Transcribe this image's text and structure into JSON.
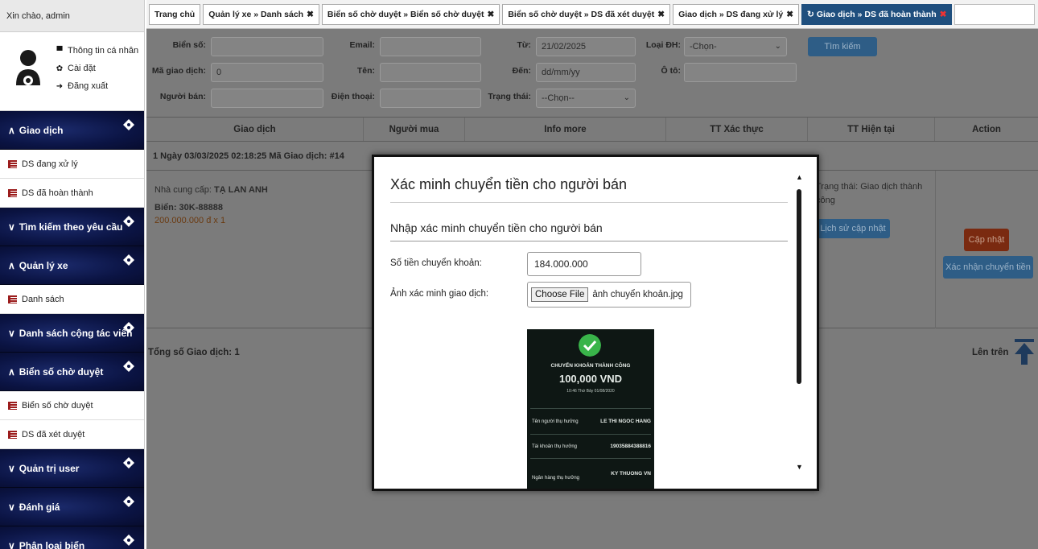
{
  "sidebar": {
    "greeting": "Xin chào, admin",
    "profile_links": [
      {
        "icon": "comment-icon",
        "label": "Thông tin cá nhân"
      },
      {
        "icon": "gear-icon",
        "label": "Cài đặt"
      },
      {
        "icon": "logout-icon",
        "label": "Đăng xuất"
      }
    ],
    "sections": [
      {
        "title": "Giao dịch",
        "expanded": true,
        "items": [
          "DS đang xử lý",
          "DS đã hoàn thành"
        ]
      },
      {
        "title": "Tìm kiếm theo yêu cầu",
        "expanded": false,
        "items": []
      },
      {
        "title": "Quản lý xe",
        "expanded": true,
        "items": [
          "Danh sách"
        ]
      },
      {
        "title": "Danh sách cộng tác viên",
        "expanded": false,
        "items": []
      },
      {
        "title": "Biển số chờ duyệt",
        "expanded": true,
        "items": [
          "Biển số chờ duyệt",
          "DS đã xét duyệt"
        ]
      },
      {
        "title": "Quản trị user",
        "expanded": false,
        "items": []
      },
      {
        "title": "Đánh giá",
        "expanded": false,
        "items": []
      },
      {
        "title": "Phân loại biển",
        "expanded": false,
        "items": []
      }
    ]
  },
  "tabs": [
    {
      "label": "Trang chủ",
      "closable": false
    },
    {
      "label": "Quản lý xe » Danh sách",
      "closable": true
    },
    {
      "label": "Biển số chờ duyệt » Biển số chờ duyệt",
      "closable": true
    },
    {
      "label": "Biển số chờ duyệt » DS đã xét duyệt",
      "closable": true
    },
    {
      "label": "Giao dịch » DS đang xử lý",
      "closable": true
    },
    {
      "label": "Giao dịch » DS đã hoàn thành",
      "closable": true,
      "active": true
    }
  ],
  "filters": {
    "bien_so_label": "Biển số:",
    "bien_so_value": "",
    "ma_gd_label": "Mã giao dịch:",
    "ma_gd_value": "0",
    "nguoi_ban_label": "Người bán:",
    "nguoi_ban_value": "",
    "email_label": "Email:",
    "email_value": "",
    "ten_label": "Tên:",
    "ten_value": "",
    "dien_thoai_label": "Điện thoại:",
    "dien_thoai_value": "",
    "tu_label": "Từ:",
    "tu_value": "21/02/2025",
    "den_label": "Đến:",
    "den_placeholder": "dd/mm/yy",
    "trang_thai_label": "Trạng thái:",
    "trang_thai_value": "--Chọn--",
    "loai_dh_label": "Loại ĐH:",
    "loai_dh_value": "-Chọn-",
    "oto_label": "Ô tô:",
    "oto_value": "",
    "search_button": "Tìm kiếm"
  },
  "table": {
    "columns": [
      "Giao dịch",
      "Người mua",
      "Info more",
      "TT Xác thực",
      "TT Hiện tại",
      "Action"
    ],
    "row_header": "1   Ngày 03/03/2025 02:18:25   Mã Giao dịch: #14",
    "provider_label": "Nhà cung cấp: ",
    "provider_name": "TẠ LAN ANH",
    "plate": "Biển: 30K-88888",
    "price": "200.000.000 đ x 1",
    "status_text": "Trạng thái: Giao dịch thành công",
    "history_button": "Lịch sử cập nhật",
    "update_button": "Cập nhật",
    "confirm_button": "Xác nhận chuyển tiền",
    "total": "Tổng số Giao dịch: 1",
    "to_top": "Lên trên"
  },
  "modal": {
    "title": "Xác minh chuyển tiền cho người bán",
    "subtitle": "Nhập xác minh chuyển tiền cho người bán",
    "amount_label": "Số tiền chuyển khoản:",
    "amount_value": "184.000.000",
    "image_label": "Ảnh xác minh giao dịch:",
    "file_button": "Choose File",
    "file_name": "ảnh chuyển khoản.jpg",
    "receipt": {
      "title": "CHUYỂN KHOẢN THÀNH CÔNG",
      "amount": "100,000 VND",
      "time": "10:46 Thứ Bảy 01/08/2020",
      "rows": [
        {
          "label": "Tên người thụ hưởng",
          "value": "LE THI NGOC HANG"
        },
        {
          "label": "Tài khoản thụ hưởng",
          "value": "19035884388816"
        },
        {
          "label": "Ngân hàng thụ hưởng",
          "value": "KY THUONG VN"
        }
      ]
    }
  },
  "colors": {
    "sidebar_header": "#0b1444",
    "overlay_gray": "#7b7b7b",
    "active_tab": "#1f4f7e",
    "update_btn": "#7a2a10",
    "success_green": "#39b44a"
  }
}
